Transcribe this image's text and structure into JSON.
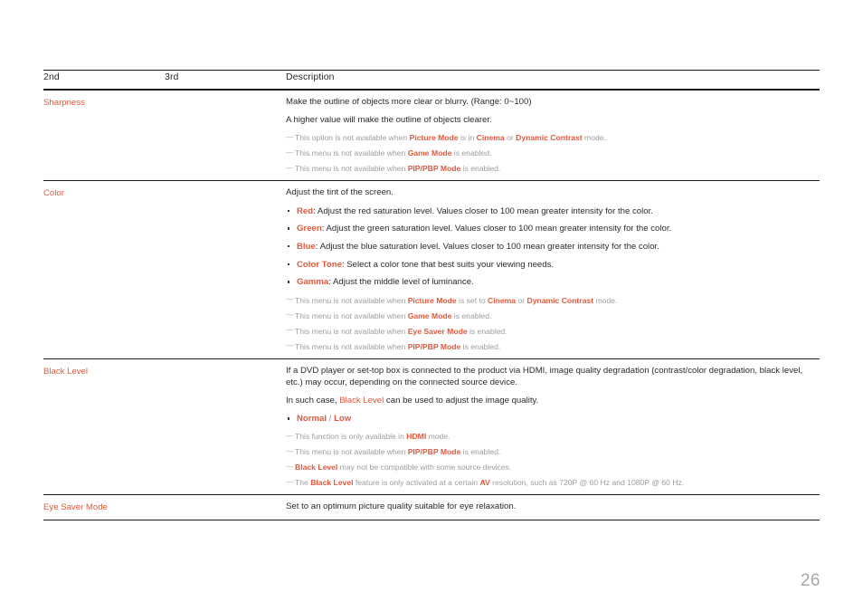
{
  "document": {
    "page_number": "26",
    "accent_color": "#e2583c",
    "note_color": "#9d9d9d",
    "rule_color": "#1b1b1b"
  },
  "table": {
    "headers": {
      "col1": "2nd",
      "col2": "3rd",
      "col3": "Description"
    },
    "rows": [
      {
        "label": "Sharpness",
        "third": "",
        "paragraphs": [
          "Make the outline of objects more clear or blurry. (Range: 0~100)",
          "A higher value will make the outline of objects clearer."
        ],
        "bullets": [],
        "notes": [
          {
            "segments": [
              {
                "text": "This option is not available when ",
                "style": "note"
              },
              {
                "text": "Picture Mode",
                "style": "kw"
              },
              {
                "text": " is in ",
                "style": "note"
              },
              {
                "text": "Cinema",
                "style": "kw"
              },
              {
                "text": " or ",
                "style": "note"
              },
              {
                "text": "Dynamic Contrast",
                "style": "kw"
              },
              {
                "text": " mode.",
                "style": "note"
              }
            ]
          },
          {
            "segments": [
              {
                "text": "This menu is not available when ",
                "style": "note"
              },
              {
                "text": "Game Mode",
                "style": "kw"
              },
              {
                "text": " is enabled.",
                "style": "note"
              }
            ]
          },
          {
            "segments": [
              {
                "text": "This menu is not available when ",
                "style": "note"
              },
              {
                "text": "PIP/PBP Mode",
                "style": "kw"
              },
              {
                "text": " is enabled.",
                "style": "note"
              }
            ]
          }
        ]
      },
      {
        "label": "Color",
        "third": "",
        "paragraphs": [
          "Adjust the tint of the screen."
        ],
        "bullets": [
          {
            "segments": [
              {
                "text": "Red",
                "style": "kw"
              },
              {
                "text": ": Adjust the red saturation level. Values closer to 100 mean greater intensity for the color.",
                "style": "body"
              }
            ]
          },
          {
            "segments": [
              {
                "text": "Green",
                "style": "kw"
              },
              {
                "text": ": Adjust the green saturation level. Values closer to 100 mean greater intensity for the color.",
                "style": "body"
              }
            ]
          },
          {
            "segments": [
              {
                "text": "Blue",
                "style": "kw"
              },
              {
                "text": ": Adjust the blue saturation level. Values closer to 100 mean greater intensity for the color.",
                "style": "body"
              }
            ]
          },
          {
            "segments": [
              {
                "text": "Color Tone",
                "style": "kw"
              },
              {
                "text": ": Select a color tone that best suits your viewing needs.",
                "style": "body"
              }
            ]
          },
          {
            "segments": [
              {
                "text": "Gamma",
                "style": "kw"
              },
              {
                "text": ": Adjust the middle level of luminance.",
                "style": "body"
              }
            ]
          }
        ],
        "notes": [
          {
            "segments": [
              {
                "text": "This menu is not available when ",
                "style": "note"
              },
              {
                "text": "Picture Mode",
                "style": "kw"
              },
              {
                "text": " is set to ",
                "style": "note"
              },
              {
                "text": "Cinema",
                "style": "kw"
              },
              {
                "text": " or ",
                "style": "note"
              },
              {
                "text": "Dynamic Contrast",
                "style": "kw"
              },
              {
                "text": " mode.",
                "style": "note"
              }
            ]
          },
          {
            "segments": [
              {
                "text": "This menu is not available when ",
                "style": "note"
              },
              {
                "text": "Game Mode",
                "style": "kw"
              },
              {
                "text": " is enabled.",
                "style": "note"
              }
            ]
          },
          {
            "segments": [
              {
                "text": "This menu is not available when ",
                "style": "note"
              },
              {
                "text": "Eye Saver Mode",
                "style": "kw"
              },
              {
                "text": " is enabled.",
                "style": "note"
              }
            ]
          },
          {
            "segments": [
              {
                "text": "This menu is not available when ",
                "style": "note"
              },
              {
                "text": "PIP/PBP Mode",
                "style": "kw"
              },
              {
                "text": " is enabled.",
                "style": "note"
              }
            ]
          }
        ]
      },
      {
        "label": "Black Level",
        "third": "",
        "paragraphs": [
          "If a DVD player or set-top box is connected to the product via HDMI, image quality degradation (contrast/color degradation, black level, etc.) may occur, depending on the connected source device."
        ],
        "paragraph2_segments": [
          {
            "text": "In such case, ",
            "style": "body"
          },
          {
            "text": "Black Level",
            "style": "kw-plain"
          },
          {
            "text": " can be used to adjust the image quality.",
            "style": "body"
          }
        ],
        "bullets": [
          {
            "segments": [
              {
                "text": "Normal",
                "style": "kw"
              },
              {
                "text": " / ",
                "style": "sep"
              },
              {
                "text": "Low",
                "style": "kw"
              }
            ]
          }
        ],
        "notes": [
          {
            "segments": [
              {
                "text": "This function is only available in ",
                "style": "note"
              },
              {
                "text": "HDMI",
                "style": "kw"
              },
              {
                "text": " mode.",
                "style": "note"
              }
            ]
          },
          {
            "segments": [
              {
                "text": "This menu is not available when ",
                "style": "note"
              },
              {
                "text": "PIP/PBP Mode",
                "style": "kw"
              },
              {
                "text": " is enabled.",
                "style": "note"
              }
            ]
          },
          {
            "segments": [
              {
                "text": "Black Level",
                "style": "kw"
              },
              {
                "text": " may not be compatible with some source devices.",
                "style": "note"
              }
            ]
          },
          {
            "segments": [
              {
                "text": "The ",
                "style": "note"
              },
              {
                "text": "Black Level",
                "style": "kw"
              },
              {
                "text": " feature is only activated at a certain ",
                "style": "note"
              },
              {
                "text": "AV",
                "style": "kw"
              },
              {
                "text": " resolution, such as 720P @ 60 Hz and 1080P @ 60 Hz.",
                "style": "note"
              }
            ]
          }
        ]
      },
      {
        "label": "Eye Saver Mode",
        "third": "",
        "paragraphs": [
          "Set to an optimum picture quality suitable for eye relaxation."
        ],
        "bullets": [],
        "notes": []
      }
    ]
  }
}
